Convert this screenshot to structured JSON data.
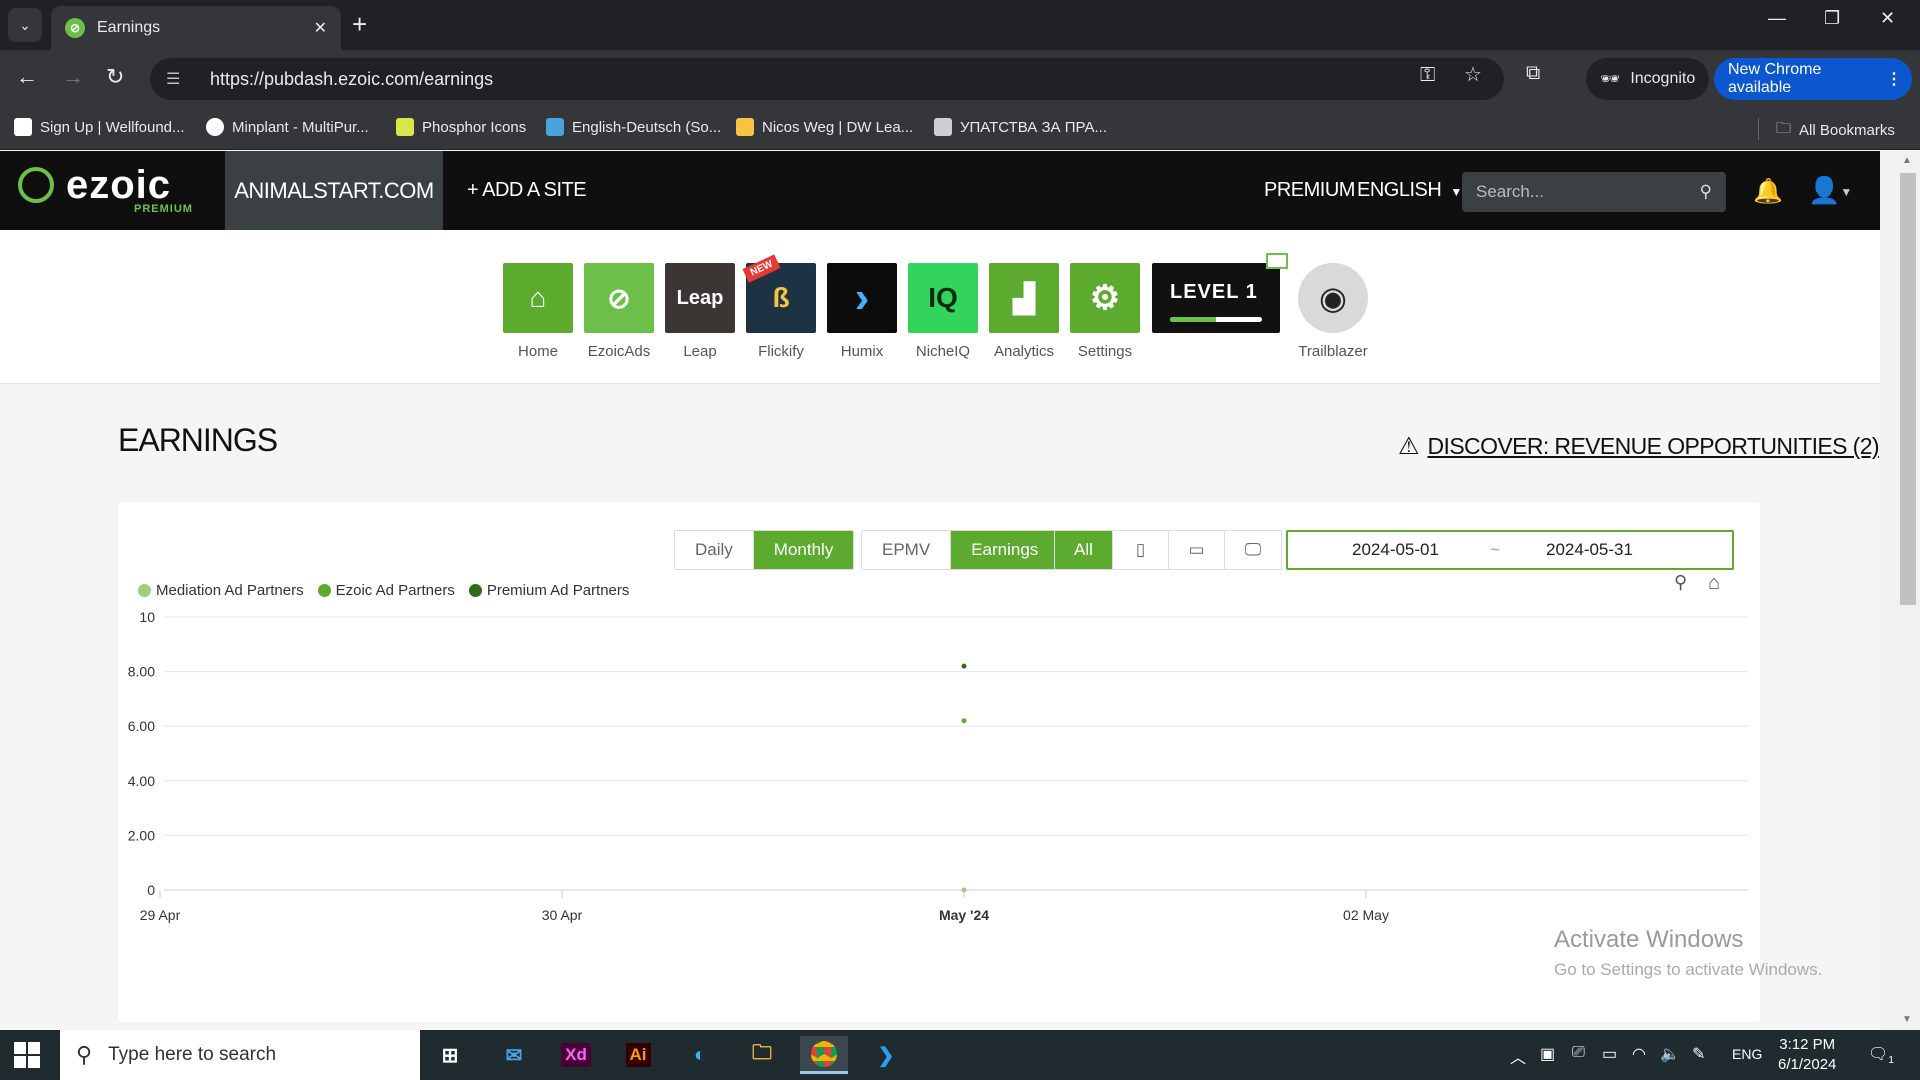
{
  "browser": {
    "tab_title": "Earnings",
    "url": "https://pubdash.ezoic.com/earnings",
    "incognito_label": "Incognito",
    "update_label": "New Chrome available",
    "bookmarks": [
      {
        "label": "Sign Up | Wellfound...",
        "color": "#ffffff"
      },
      {
        "label": "Minplant - MultiPur...",
        "color": "#ffffff"
      },
      {
        "label": "Phosphor Icons",
        "color": "#d6e64b"
      },
      {
        "label": "English-Deutsch (So...",
        "color": "#4aa3df"
      },
      {
        "label": "Nicos Weg | DW Lea...",
        "color": "#f6c343"
      },
      {
        "label": "УПАТСТВА ЗА ПРА...",
        "color": "#cfcfcf"
      }
    ],
    "all_bookmarks_label": "All Bookmarks"
  },
  "header": {
    "logo_text": "ezoic",
    "logo_sub": "PREMIUM",
    "site_name": "ANIMALSTART.COM",
    "add_site": "+ ADD A SITE",
    "premium": "PREMIUM",
    "language": "ENGLISH",
    "search_placeholder": "Search..."
  },
  "apps": [
    {
      "label": "Home",
      "color": "#5cab2e",
      "glyph": "⌂"
    },
    {
      "label": "EzoicAds",
      "color": "#6cc04a",
      "glyph": "⊘"
    },
    {
      "label": "Leap",
      "color": "#3b3633",
      "glyph": "Leap"
    },
    {
      "label": "Flickify",
      "color": "#1d3344",
      "glyph": "ß"
    },
    {
      "label": "Humix",
      "color": "#0c0c0c",
      "glyph": "›"
    },
    {
      "label": "NicheIQ",
      "color": "#33d45c",
      "glyph": "IQ"
    },
    {
      "label": "Analytics",
      "color": "#5cab2e",
      "glyph": "▟"
    },
    {
      "label": "Settings",
      "color": "#5cab2e",
      "glyph": "⚙"
    }
  ],
  "new_badge": "NEW",
  "level": {
    "label": "LEVEL 1",
    "progress": 0.5
  },
  "trailblazer_label": "Trailblazer",
  "page": {
    "title": "EARNINGS",
    "discover_link": "DISCOVER: REVENUE OPPORTUNITIES (2)"
  },
  "controls": {
    "period": [
      "Daily",
      "Monthly"
    ],
    "period_selected": "Monthly",
    "metric": [
      "EPMV",
      "Earnings"
    ],
    "metric_selected": "Earnings",
    "device_all": "All",
    "date_from": "2024-05-01",
    "date_sep": "~",
    "date_to": "2024-05-31"
  },
  "chart_data": {
    "type": "scatter",
    "legend_position": "top-left",
    "grid": true,
    "series": [
      {
        "name": "Mediation Ad Partners",
        "color": "#9bd17a",
        "points": [
          [
            "May '24",
            0
          ]
        ]
      },
      {
        "name": "Ezoic Ad Partners",
        "color": "#5cab2e",
        "points": [
          [
            "May '24",
            6.2
          ]
        ]
      },
      {
        "name": "Premium Ad Partners",
        "color": "#2e6b1a",
        "points": [
          [
            "May '24",
            8.2
          ]
        ]
      }
    ],
    "x_ticks": [
      "29 Apr",
      "30 Apr",
      "May '24",
      "02 May"
    ],
    "y_ticks": [
      "10",
      "8.00",
      "6.00",
      "4.00",
      "2.00",
      "0"
    ],
    "ylim": [
      0,
      10
    ]
  },
  "watermark": {
    "line1": "Activate Windows",
    "line2": "Go to Settings to activate Windows."
  },
  "taskbar": {
    "search_placeholder": "Type here to search",
    "language": "ENG",
    "time": "3:12 PM",
    "date": "6/1/2024",
    "notif_count": "1"
  }
}
